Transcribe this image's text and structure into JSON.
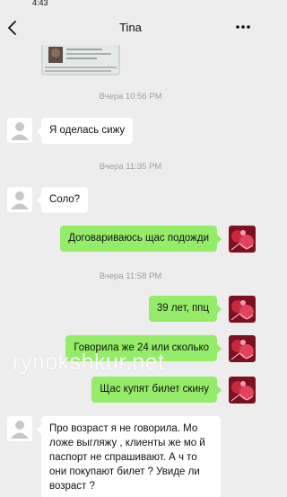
{
  "status_bar": {
    "time": "4:43"
  },
  "header": {
    "title": "Tina"
  },
  "messages": [
    {
      "timestamp": "Вчера 10:56 PM"
    },
    {
      "text": "Я оделась сижу"
    },
    {
      "timestamp": "Вчера 11:35 PM"
    },
    {
      "text": "Соло?"
    },
    {
      "text": "Договариваюсь щас подожди"
    },
    {
      "timestamp": "Вчера 11:58 PM"
    },
    {
      "text": "39 лет, ппц"
    },
    {
      "text": "Говорила же 24 или сколько"
    },
    {
      "text": "Щас купят билет скину"
    },
    {
      "text": "Про возраст я не говорила. Мо ложе выгляжу , клиенты же мо й паспорт не спрашивают. А ч то они покупают билет ? Увиде ли возраст ?"
    }
  ],
  "watermark": "rynokshkur.net",
  "colors": {
    "background": "#ededed",
    "incoming_bubble": "#ffffff",
    "outgoing_bubble": "#95ec69",
    "timestamp": "#9e9e9e"
  },
  "icons": {
    "back": "chevron-left-icon",
    "more": "more-dots-icon",
    "contact_avatar": "default-avatar-icon",
    "user_avatar": "red-photo-avatar"
  }
}
